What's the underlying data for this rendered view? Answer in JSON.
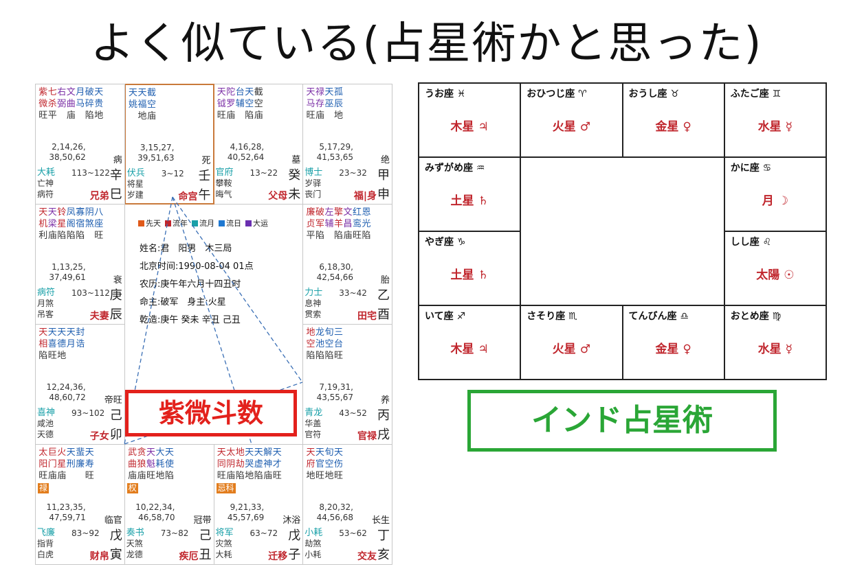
{
  "title": "よく似ている(占星術かと思った)",
  "ziwei": {
    "label": "紫微斗数",
    "legend": [
      {
        "name": "先天",
        "color": "#e05a1a"
      },
      {
        "name": "流年",
        "color": "#c0262d"
      },
      {
        "name": "流月",
        "color": "#1aa0a8"
      },
      {
        "name": "流日",
        "color": "#1f78d1"
      },
      {
        "name": "大运",
        "color": "#6a2fb0"
      }
    ],
    "info": [
      "姓名:君　阳男　木三局",
      "北京时间:1990-08-04 01点",
      "农历:庚午年六月十四丑时",
      "命主:破军　身主:火星",
      "乾造:庚午 癸未 辛丑 己丑"
    ],
    "cells": [
      {
        "r1": "紫七右文月破天",
        "c1": [
          "red",
          "red",
          "pur",
          "pur",
          "blu",
          "blu",
          "blu"
        ],
        "r2": "微杀弼曲马碎贵",
        "r3": "旺平　庙　陷地",
        "tag": "",
        "ages": "2,14,26,\n38,50,62",
        "stage": "病",
        "g1": "大耗",
        "rng": "113~122",
        "g2": "亡神",
        "g3": "病符",
        "pal": "兄弟",
        "stem": "辛",
        "branch": "巳"
      },
      {
        "r1": "天天截",
        "c1": [
          "blu",
          "blu",
          "blu"
        ],
        "r2": "姚福空",
        "r3": "　地庙",
        "tag": "",
        "ages": "3,15,27,\n39,51,63",
        "stage": "死",
        "g1": "伏兵",
        "rng": "3~12",
        "g2": "将星",
        "g3": "岁建",
        "pal": "命宫",
        "stem": "壬",
        "branch": "午"
      },
      {
        "r1": "天陀台天截",
        "c1": [
          "pur",
          "pur",
          "blu",
          "blu",
          "drk"
        ],
        "r2": "钺罗辅空空",
        "r3": "旺庙　陷庙",
        "tag": "",
        "ages": "4,16,28,\n40,52,64",
        "stage": "墓",
        "g1": "官府",
        "rng": "13~22",
        "g2": "攀鞍",
        "g3": "晦气",
        "pal": "父母",
        "stem": "癸",
        "branch": "未"
      },
      {
        "r1": "天禄天孤",
        "c1": [
          "pur",
          "pur",
          "blu",
          "blu"
        ],
        "r2": "马存巫辰",
        "r3": "旺庙　地",
        "tag": "",
        "ages": "5,17,29,\n41,53,65",
        "stage": "绝",
        "g1": "博士",
        "rng": "23~32",
        "g2": "岁驿",
        "g3": "丧门",
        "pal": "福|身",
        "stem": "甲",
        "branch": "申"
      },
      {
        "r1": "天天铃凤寡阴八",
        "c1": [
          "red",
          "pur",
          "red",
          "blu",
          "blu",
          "blu",
          "blu"
        ],
        "r2": "机梁星阁宿煞座",
        "r3": "利庙陷陷陷　旺",
        "tag": "",
        "ages": "1,13,25,\n37,49,61",
        "stage": "衰",
        "g1": "病符",
        "rng": "103~112",
        "g2": "月煞",
        "g3": "吊客",
        "pal": "夫妻",
        "stem": "庚",
        "branch": "辰"
      },
      {
        "r1": "廉破左擎文红恩",
        "c1": [
          "red",
          "red",
          "pur",
          "red",
          "pur",
          "blu",
          "blu"
        ],
        "r2": "贞军辅羊昌鸾光",
        "r3": "平陷　陷庙旺陷",
        "tag": "",
        "ages": "6,18,30,\n42,54,66",
        "stage": "胎",
        "g1": "力士",
        "rng": "33~42",
        "g2": "息神",
        "g3": "贯索",
        "pal": "田宅",
        "stem": "乙",
        "branch": "酉"
      },
      {
        "r1": "天天天天封",
        "c1": [
          "red",
          "blu",
          "blu",
          "blu",
          "blu"
        ],
        "r2": "相喜德月诰",
        "r3": "陷旺地",
        "tag": "",
        "ages": "12,24,36,\n48,60,72",
        "stage": "帝旺",
        "g1": "喜神",
        "rng": "93~102",
        "g2": "咸池",
        "g3": "天德",
        "pal": "子女",
        "stem": "己",
        "branch": "卯"
      },
      {
        "r1": "地龙旬三",
        "c1": [
          "red",
          "blu",
          "blu",
          "blu"
        ],
        "r2": "空池空台",
        "r3": "陷陷陷旺",
        "tag": "",
        "ages": "7,19,31,\n43,55,67",
        "stage": "养",
        "g1": "青龙",
        "rng": "43~52",
        "g2": "华盖",
        "g3": "官符",
        "pal": "官禄",
        "stem": "丙",
        "branch": "戌"
      },
      {
        "r1": "太巨火天蜚天",
        "c1": [
          "red",
          "red",
          "red",
          "blu",
          "blu",
          "blu"
        ],
        "r2": "阳门星刑廉寿",
        "r3": "旺庙庙　　旺",
        "tag": "禄",
        "ages": "11,23,35,\n47,59,71",
        "stage": "临官",
        "g1": "飞廉",
        "rng": "83~92",
        "g2": "指背",
        "g3": "白虎",
        "pal": "财帛",
        "stem": "戊",
        "branch": "寅"
      },
      {
        "r1": "武贪天大天",
        "c1": [
          "red",
          "red",
          "pur",
          "blu",
          "blu"
        ],
        "r2": "曲狼魁耗使",
        "r3": "庙庙旺地陷",
        "tag": "权",
        "ages": "10,22,34,\n46,58,70",
        "stage": "冠带",
        "g1": "奏书",
        "rng": "73~82",
        "g2": "天煞",
        "g3": "龙德",
        "pal": "疾厄",
        "stem": "己",
        "branch": "丑"
      },
      {
        "r1": "天太地天天解天",
        "c1": [
          "red",
          "red",
          "red",
          "blu",
          "blu",
          "blu",
          "blu"
        ],
        "r2": "同阴劫哭虚神才",
        "r3": "旺庙陷地陷庙旺",
        "tag": "忌科",
        "ages": "9,21,33,\n45,57,69",
        "stage": "沐浴",
        "g1": "将军",
        "rng": "63~72",
        "g2": "灾煞",
        "g3": "大耗",
        "pal": "迁移",
        "stem": "戊",
        "branch": "子"
      },
      {
        "r1": "天天旬天",
        "c1": [
          "red",
          "blu",
          "blu",
          "blu"
        ],
        "r2": "府官空伤",
        "r3": "地旺地旺",
        "tag": "",
        "ages": "8,20,32,\n44,56,68",
        "stage": "长生",
        "g1": "小耗",
        "rng": "53~62",
        "g2": "劫煞",
        "g3": "小耗",
        "pal": "交友",
        "stem": "丁",
        "branch": "亥"
      }
    ]
  },
  "india": {
    "label": "インド占星術",
    "cells": [
      {
        "name": "うお座 ♓",
        "planet": "木星 ♃"
      },
      {
        "name": "おひつじ座 ♈",
        "planet": "火星 ♂"
      },
      {
        "name": "おうし座 ♉",
        "planet": "金星 ♀"
      },
      {
        "name": "ふたご座 ♊",
        "planet": "水星 ☿"
      },
      {
        "name": "かに座 ♋",
        "planet": "月 ☽"
      },
      {
        "name": "しし座 ♌",
        "planet": "太陽 ☉"
      },
      {
        "name": "おとめ座 ♍",
        "planet": "水星 ☿"
      },
      {
        "name": "てんびん座 ♎",
        "planet": "金星 ♀"
      },
      {
        "name": "さそり座 ♏",
        "planet": "火星 ♂"
      },
      {
        "name": "いて座 ♐",
        "planet": "木星 ♃"
      },
      {
        "name": "やぎ座 ♑",
        "planet": "土星 ♄"
      },
      {
        "name": "みずがめ座 ♒",
        "planet": "土星 ♄"
      }
    ]
  }
}
